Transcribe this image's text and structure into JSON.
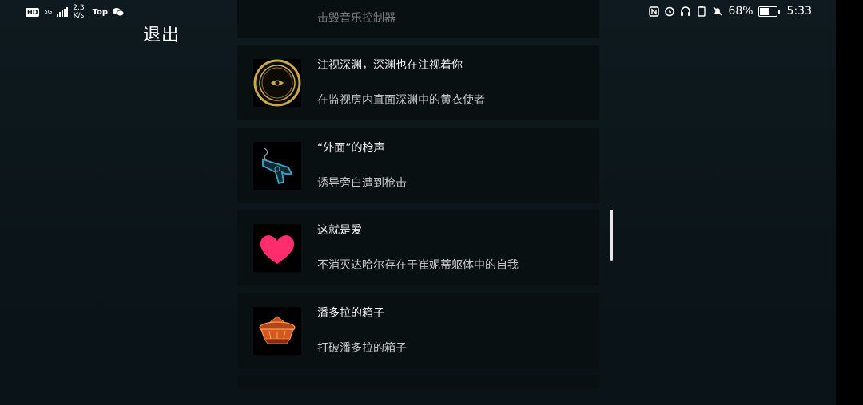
{
  "status_bar": {
    "network_speed_value": "2.3",
    "network_speed_unit": "K/s",
    "app_tag": "Top",
    "hd_label": "HD",
    "network_type": "5G",
    "battery_percent": "68%",
    "battery_level": 0.68,
    "time": "5:33"
  },
  "exit_label": "退出",
  "achievements": [
    {
      "title": "",
      "desc": "击毁音乐控制器"
    },
    {
      "title": "注视深渊，深渊也在注视着你",
      "desc": "在监视房内直面深渊中的黄衣使者",
      "icon": "eye-medallion-icon"
    },
    {
      "title": "“外面”的枪声",
      "desc": "诱导旁白遭到枪击",
      "icon": "revolver-icon"
    },
    {
      "title": "这就是爱",
      "desc": "不消灭达哈尔存在于崔妮蒂躯体中的自我",
      "icon": "heart-icon"
    },
    {
      "title": "潘多拉的箱子",
      "desc": "打破潘多拉的箱子",
      "icon": "pandora-box-icon"
    }
  ],
  "colors": {
    "background": "#0b1519",
    "card": "#081012",
    "heart": "#ff2d6e",
    "gold": "#c9a94b",
    "gun": "#3aa6c7",
    "box": "#e8632a"
  }
}
